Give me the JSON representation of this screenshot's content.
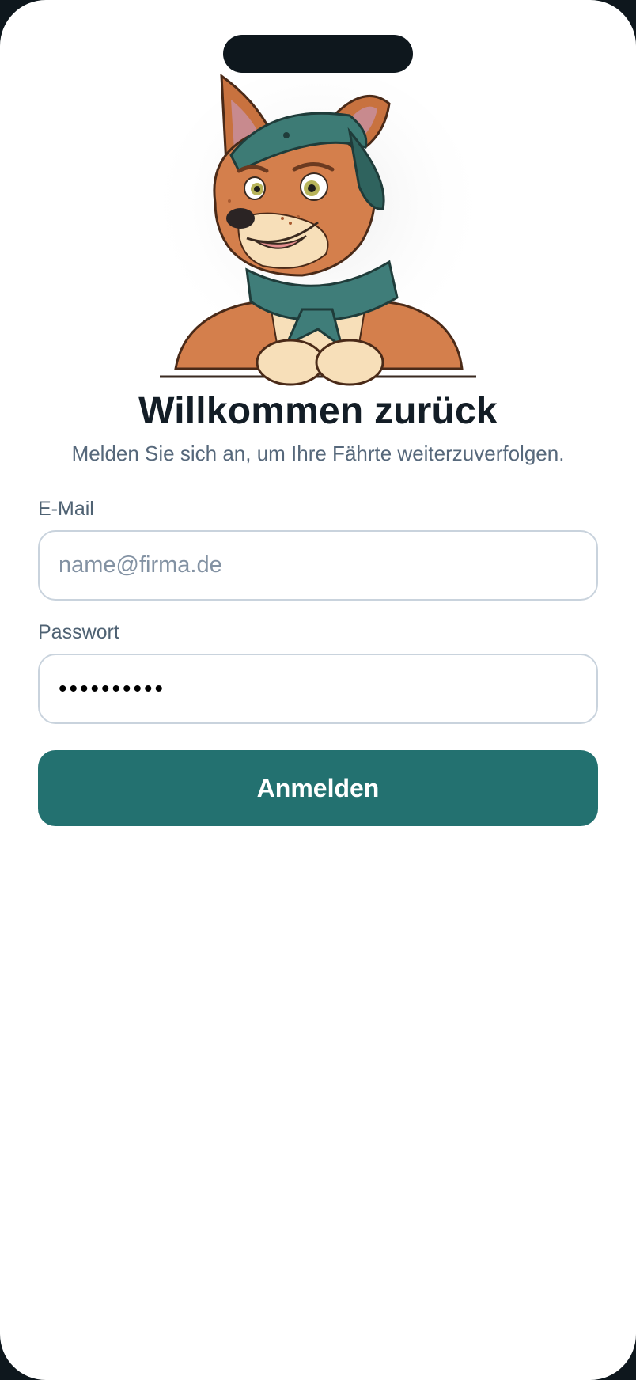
{
  "header": {
    "title": "Willkommen zurück",
    "subtitle": "Melden Sie sich an, um Ihre Fährte weiterzuverfolgen."
  },
  "mascot": {
    "icon": "wolf-scout-mascot-icon",
    "colors": {
      "fur": "#d47f4c",
      "fur_dark": "#a85a30",
      "cream": "#f7dfb9",
      "cap": "#3d7b75",
      "scarf": "#3f7d79"
    }
  },
  "form": {
    "email_label": "E-Mail",
    "email_placeholder": "name@firma.de",
    "email_value": "",
    "password_label": "Passwort",
    "password_value": "••••••••••",
    "submit_label": "Anmelden"
  },
  "colors": {
    "accent": "#237170",
    "title_text": "#131d26",
    "muted_text": "#56687b",
    "field_border": "#c9d3dd"
  }
}
